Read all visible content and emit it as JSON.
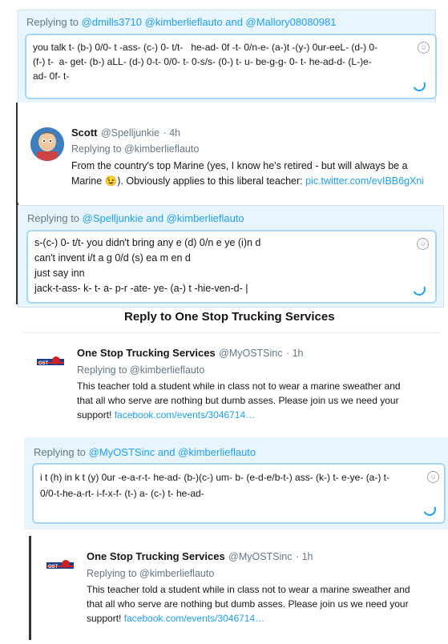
{
  "panel1": {
    "reply_label": "Replying to",
    "reply_handles": "@dmills3710 @kimberlieflauto and @Mallory08080981",
    "compose_text": "you talk t- (b-) 0/0- t -ass- (c-) 0- t/t-   he-ad- 0f -t- 0/n-e- (a-)t -(y-) 0ur-eeL- (d-) 0-\n(f-) t-  a- get- (b-) aLL- (d-) 0-t- 0/0- t- 0-s/s- (0-) t- u- be-g-g- 0- t- he-ad-d- (L-)e-\nad- 0f- t-"
  },
  "panel2": {
    "name": "Scott",
    "handle": "@Spelljunkie",
    "time": "· 4h",
    "replying_to": "Replying to @kimberlieflauto",
    "body_part1": "From the country's top Marine (yes, I know he's retired - but will always be a\nMarine ",
    "emoji": "😉",
    "body_part2": "). Obviously applies to this liberal teacher: ",
    "link": "pic.twitter.com/evIBB6gXni",
    "reply_label": "Replying to",
    "reply_handles": "@Spelljunkie and @kimberlieflauto",
    "compose_lines": [
      "s-(c-) 0- t/t- you didn't bring any e (d) 0/n e ye (i)n d",
      "can't invent i/t a g 0/d (s) ea m en d",
      "just say inn",
      "jack-t-ass- k- t- a- p-r -ate- ye- (a-) t -hie-ven-d- |"
    ]
  },
  "panel3": {
    "header": "Reply to One Stop Trucking Services",
    "logo_text": "OST",
    "name": "One Stop Trucking Services",
    "handle": "@MyOSTSinc",
    "time": "· 1h",
    "replying_to": "Replying to @kimberlieflauto",
    "body": "This teacher told a student while in class not to wear a marine sweather and\nthat all who serve are nothing but dumb asses. Please join us we need your\nsupport! ",
    "link": "facebook.com/events/3046714…",
    "reply_label": "Replying to",
    "reply_handles": "@MyOSTSinc and @kimberlieflauto",
    "compose_text": "i t (h) in k t (y) 0ur -e-a-r-t- he-ad- (b-)(c-) um- b- (e-d-e/b-t-) ass- (k-) t- e-ye- (a-) t-\n0/0-t-he-a-rt- i-f-x-f- (t-) a- (c-) t- he-ad-"
  },
  "panel4": {
    "logo_text": "OST",
    "name": "One Stop Trucking Services",
    "handle": "@MyOSTSinc",
    "time": "· 1h",
    "replying_to": "Replying to @kimberlieflauto",
    "body": "This teacher told a student while in class not to wear a marine sweather and\nthat all who serve are nothing but dumb asses. Please join us we need your\nsupport! ",
    "link": "facebook.com/events/3046714…"
  },
  "icons": {
    "emoji": "emoji-icon",
    "spinner": "character-count-icon"
  },
  "colors": {
    "twitter_blue": "#1da1f2",
    "reply_bar": "#e8f5fd"
  }
}
